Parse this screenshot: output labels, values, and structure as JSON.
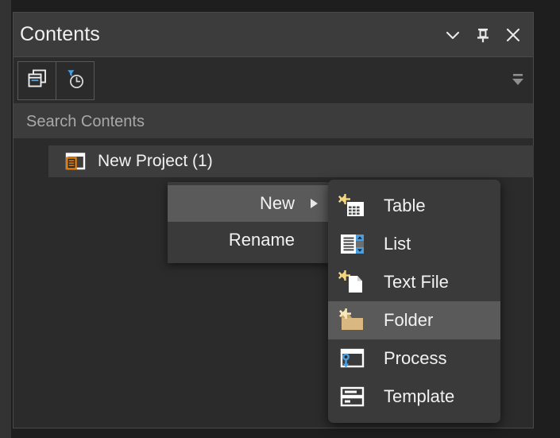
{
  "panel": {
    "title": "Contents",
    "titlebar_buttons": [
      {
        "name": "panel-menu-button",
        "icon": "chevron-down-icon"
      },
      {
        "name": "pin-panel-button",
        "icon": "pin-icon"
      },
      {
        "name": "close-panel-button",
        "icon": "close-icon"
      }
    ],
    "toolbar": {
      "buttons": [
        {
          "name": "list-by-drawing-order-button",
          "icon": "stacked-windows-icon"
        },
        {
          "name": "list-by-snapshot-time-button",
          "icon": "clock-filter-icon"
        }
      ],
      "overflow": {
        "name": "toolbar-overflow-button",
        "icon": "collapse-triangle-icon"
      }
    },
    "search": {
      "placeholder": "Search Contents",
      "value": ""
    },
    "tree": {
      "items": [
        {
          "label": "New Project (1)",
          "icon": "project-document-icon",
          "selected": true
        }
      ]
    }
  },
  "context_menu": {
    "items": [
      {
        "label": "New",
        "highlighted": true,
        "has_submenu": true
      },
      {
        "label": "Rename",
        "highlighted": false,
        "has_submenu": false
      }
    ]
  },
  "submenu": {
    "items": [
      {
        "label": "Table",
        "icon": "new-table-icon",
        "highlighted": false
      },
      {
        "label": "List",
        "icon": "new-list-icon",
        "highlighted": false
      },
      {
        "label": "Text File",
        "icon": "new-text-file-icon",
        "highlighted": false
      },
      {
        "label": "Folder",
        "icon": "new-folder-icon",
        "highlighted": true
      },
      {
        "label": "Process",
        "icon": "new-process-icon",
        "highlighted": false
      },
      {
        "label": "Template",
        "icon": "new-template-icon",
        "highlighted": false
      }
    ]
  },
  "colors": {
    "app_background": "#1e1e1e",
    "panel_background": "#2b2b2b",
    "titlebar_background": "#3c3c3c",
    "menu_background": "#3a3a3a",
    "menu_highlight": "#5a5a5a",
    "row_selected": "#3d3d3d",
    "accent_orange": "#e8820c",
    "accent_blue": "#4a9fe0",
    "accent_yellow": "#f5d77a",
    "folder_tan": "#d9b882",
    "text_primary": "#f2f2f2",
    "text_placeholder": "#a8a8a8"
  }
}
